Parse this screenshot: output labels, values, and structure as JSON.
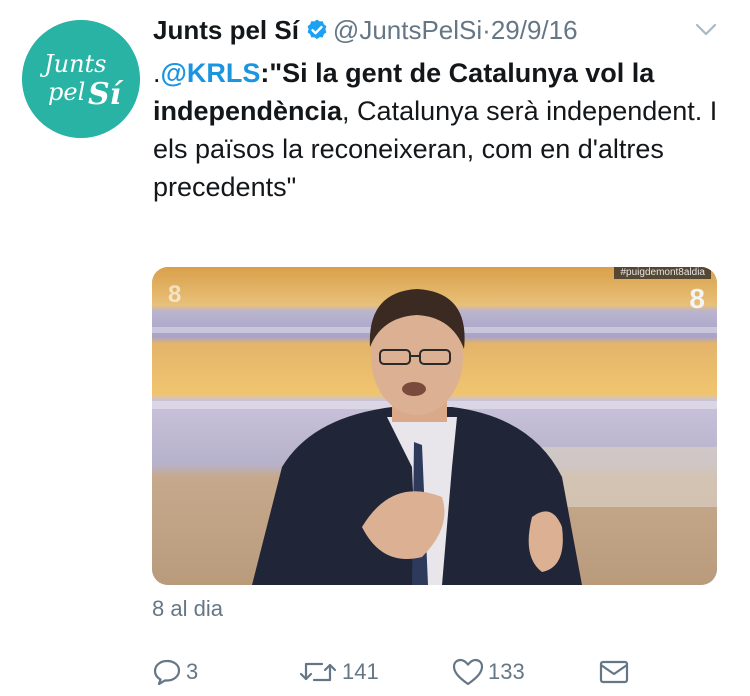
{
  "author": {
    "name": "Junts pel Sí",
    "handle": "@JuntsPelSi",
    "separator": "·",
    "date": "29/9/16",
    "avatar_text_line1": "Junts",
    "avatar_text_line2": "pel",
    "avatar_text_line3": "Sí",
    "verified_icon": "verified-badge-icon"
  },
  "tweet": {
    "prefix": ".",
    "mention": "@KRLS",
    "colon_quote": ":\"",
    "bold_part": "Si la gent de Catalunya vol la independència",
    "rest": ", Catalunya serà independent. I els països la reconeixeran, com en d'altres precedents\""
  },
  "media": {
    "hashtag": "#puigdemont8aldia",
    "logo_left": "8",
    "logo_right": "8"
  },
  "source": "8 al dia",
  "actions": {
    "reply_count": "3",
    "retweet_count": "141",
    "like_count": "133"
  },
  "colors": {
    "accent": "#1b95e0",
    "muted": "#657786",
    "text": "#14171a",
    "avatar_bg": "#29b3a4"
  }
}
